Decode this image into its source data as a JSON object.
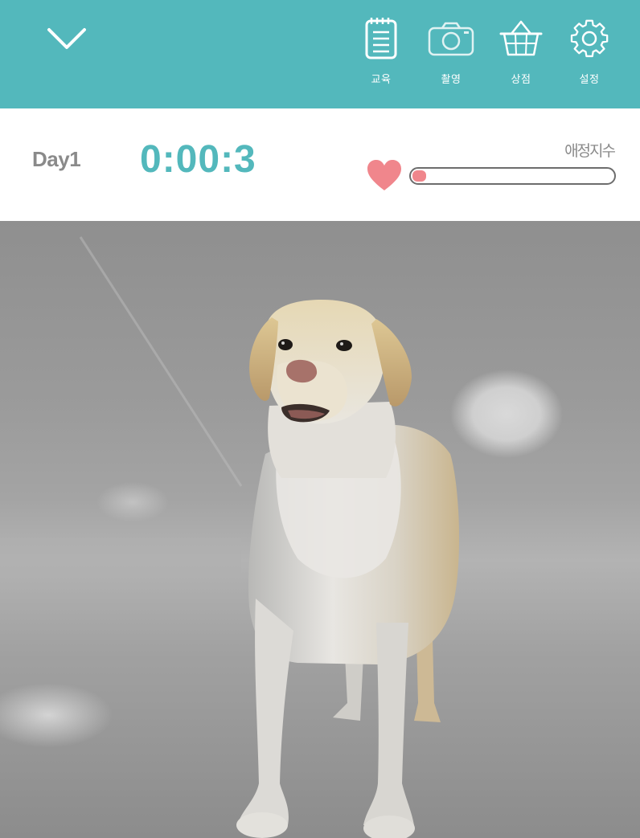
{
  "header": {
    "collapse_icon": "chevron-down-icon",
    "menu": [
      {
        "label": "교육",
        "icon": "notepad-icon"
      },
      {
        "label": "촬영",
        "icon": "camera-icon"
      },
      {
        "label": "상점",
        "icon": "basket-icon"
      },
      {
        "label": "설정",
        "icon": "gear-icon"
      }
    ]
  },
  "status": {
    "day": "Day1",
    "timer": "0:00:3",
    "affection_label": "애정지수",
    "affection_level": 0.07,
    "heart_icon": "heart-icon"
  },
  "colors": {
    "primary": "#53b8bc",
    "heart": "#f0868c",
    "label_gray": "#8a8a8a"
  },
  "scene": {
    "subject": "dog-3d-model"
  }
}
